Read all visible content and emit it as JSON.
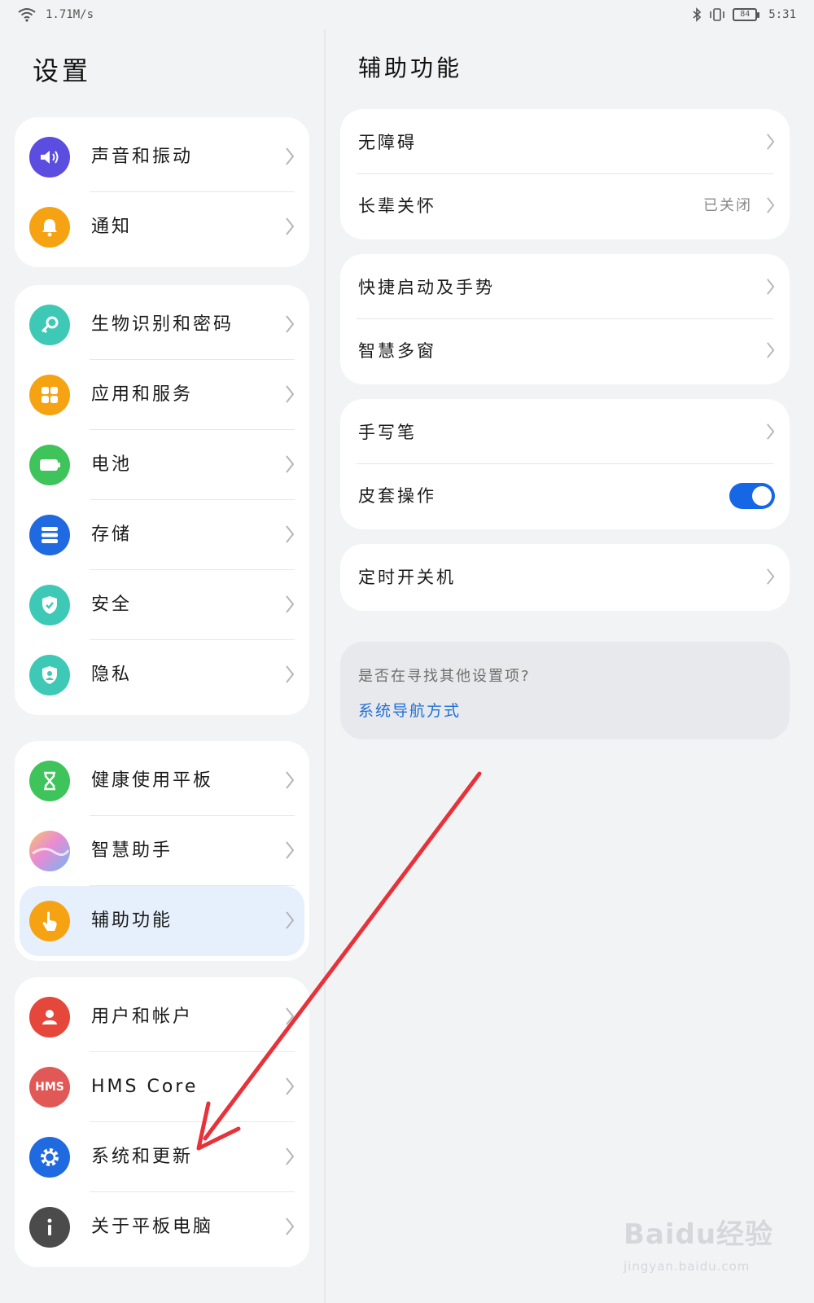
{
  "status_bar": {
    "network_speed": "1.71M/s",
    "battery_level": "84",
    "time": "5:31"
  },
  "left": {
    "title": "设置",
    "groups": [
      [
        {
          "label": "声音和振动",
          "icon": "speaker-icon",
          "color": "#5a4de0"
        },
        {
          "label": "通知",
          "icon": "bell-icon",
          "color": "#f6a313"
        }
      ],
      [
        {
          "label": "生物识别和密码",
          "icon": "key-icon",
          "color": "#3dc9b6"
        },
        {
          "label": "应用和服务",
          "icon": "apps-icon",
          "color": "#f6a313"
        },
        {
          "label": "电池",
          "icon": "battery-icon",
          "color": "#3ec45a"
        },
        {
          "label": "存储",
          "icon": "storage-icon",
          "color": "#1f6ae0"
        },
        {
          "label": "安全",
          "icon": "shield-check-icon",
          "color": "#3dc9b6"
        },
        {
          "label": "隐私",
          "icon": "privacy-shield-icon",
          "color": "#3dc9b6"
        }
      ],
      [
        {
          "label": "健康使用平板",
          "icon": "hourglass-icon",
          "color": "#3ec45a"
        },
        {
          "label": "智慧助手",
          "icon": "assistant-orb-icon",
          "color": "#c9a6f0"
        },
        {
          "label": "辅助功能",
          "icon": "hand-pointer-icon",
          "color": "#f6a313",
          "active": true
        }
      ],
      [
        {
          "label": "用户和帐户",
          "icon": "user-icon",
          "color": "#e5473b"
        },
        {
          "label": "HMS Core",
          "icon": "hms-icon",
          "icon_text": "HMS",
          "color": "#e15956"
        },
        {
          "label": "系统和更新",
          "icon": "gear-icon",
          "color": "#1f6ae0"
        },
        {
          "label": "关于平板电脑",
          "icon": "info-icon",
          "color": "#4b4b4b"
        }
      ]
    ]
  },
  "right": {
    "title": "辅助功能",
    "groups": [
      [
        {
          "label": "无障碍",
          "type": "chevron"
        },
        {
          "label": "长辈关怀",
          "value": "已关闭",
          "type": "chevron"
        }
      ],
      [
        {
          "label": "快捷启动及手势",
          "type": "chevron"
        },
        {
          "label": "智慧多窗",
          "type": "chevron"
        }
      ],
      [
        {
          "label": "手写笔",
          "type": "chevron"
        },
        {
          "label": "皮套操作",
          "type": "toggle",
          "toggle_on": true
        }
      ],
      [
        {
          "label": "定时开关机",
          "type": "chevron"
        }
      ]
    ],
    "hint": {
      "question": "是否在寻找其他设置项?",
      "link": "系统导航方式"
    }
  },
  "colors": {
    "accent": "#1567e6",
    "link": "#1f6fd6",
    "annotation_arrow": "#e8323a"
  },
  "watermark": {
    "brand": "Baidu经验",
    "url": "jingyan.baidu.com"
  }
}
